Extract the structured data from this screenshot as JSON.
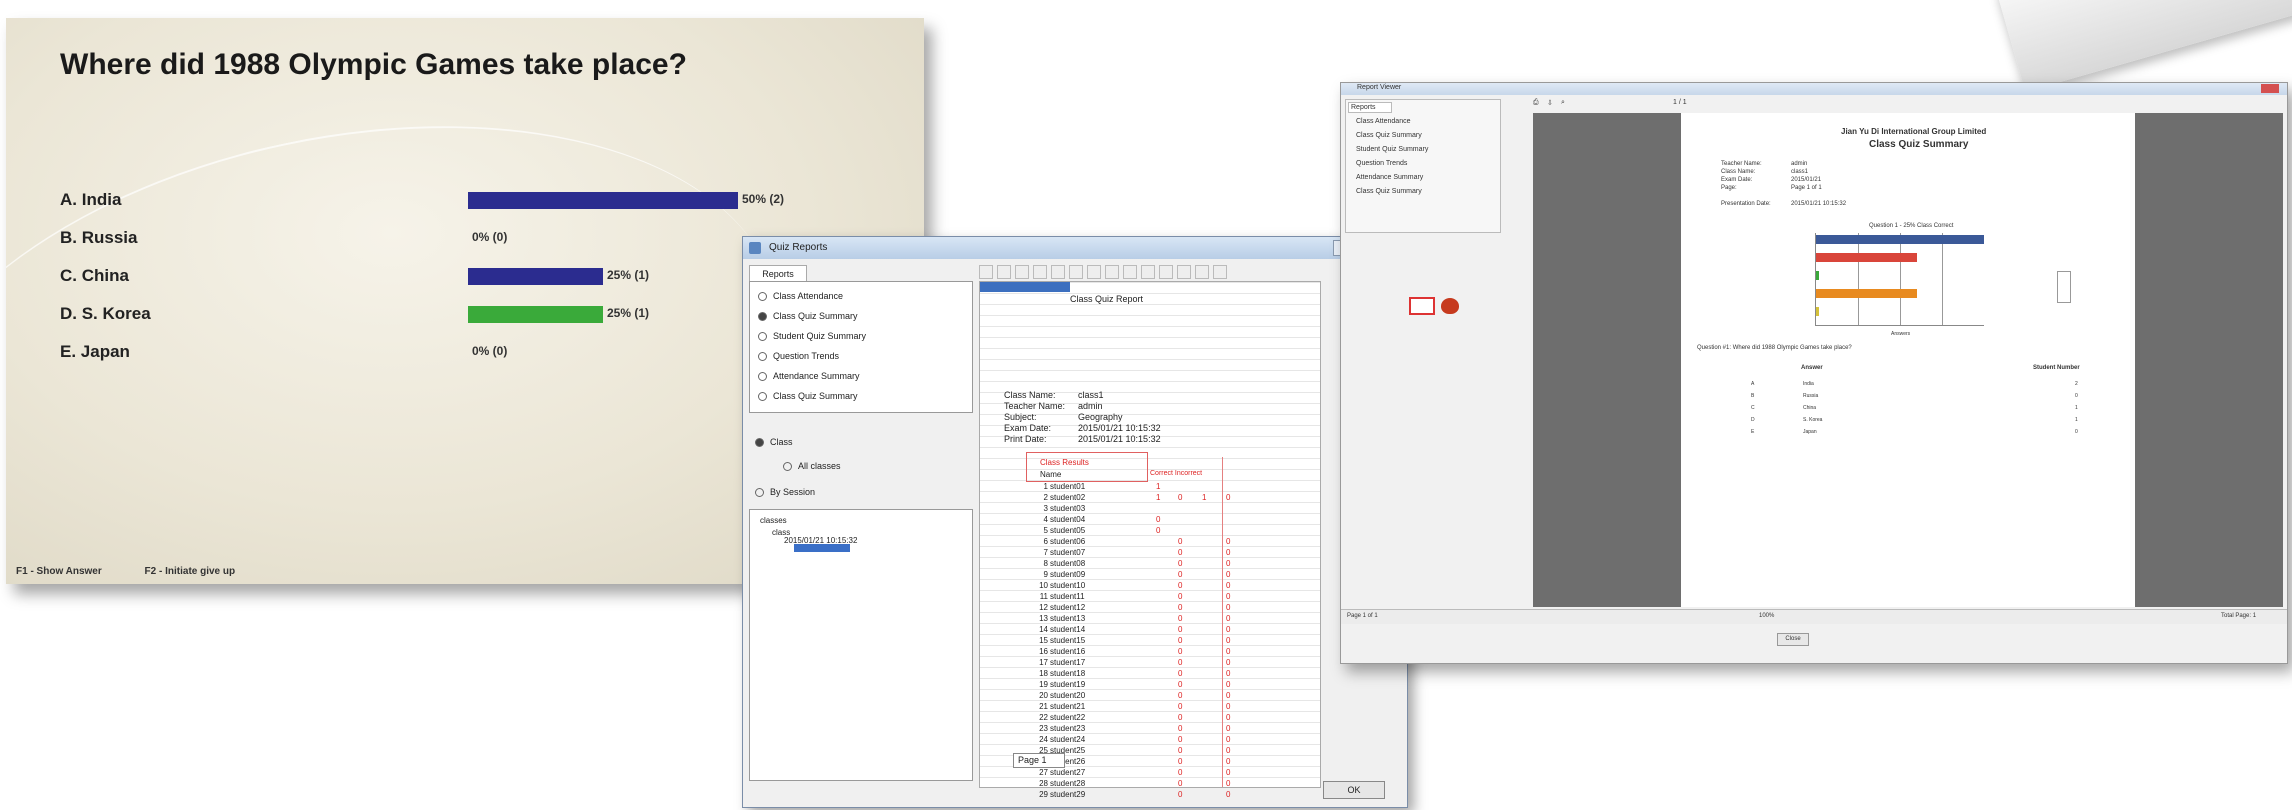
{
  "quiz": {
    "question": "Where did 1988 Olympic Games take place?",
    "answers": [
      {
        "label": "A. India",
        "percent": 50,
        "value_text": "50% (2)",
        "color": "#2b2c8f"
      },
      {
        "label": "B. Russia",
        "percent": 0,
        "value_text": "0% (0)",
        "color": "#2b2c8f"
      },
      {
        "label": "C. China",
        "percent": 25,
        "value_text": "25% (1)",
        "color": "#2b2c8f"
      },
      {
        "label": "D. S. Korea",
        "percent": 25,
        "value_text": "25% (1)",
        "color": "#3aaa3a"
      },
      {
        "label": "E. Japan",
        "percent": 0,
        "value_text": "0% (0)",
        "color": "#2b2c8f"
      }
    ],
    "footer": [
      "F1 - Show Answer",
      "F2 - Initiate give up"
    ]
  },
  "teacher": {
    "title": "Quiz Reports",
    "tab": "Reports",
    "reports": [
      "Class Attendance",
      "Class Quiz Summary",
      "Student Quiz Summary",
      "Question Trends",
      "Attendance Summary",
      "Class Quiz Summary"
    ],
    "selected_report_index": 1,
    "options": {
      "class": "Class",
      "all_classes": "All classes",
      "by_session": "By Session"
    },
    "tree": [
      "classes",
      "class",
      "2015/01/21 10:15:32"
    ],
    "quiz_header": "Class Quiz Report",
    "info": [
      {
        "k": "Class Name:",
        "v": "class1"
      },
      {
        "k": "Teacher Name:",
        "v": "admin"
      },
      {
        "k": "Subject:",
        "v": "Geography"
      },
      {
        "k": "Exam Date:",
        "v": "2015/01/21 10:15:32"
      },
      {
        "k": "Print Date:",
        "v": "2015/01/21 10:15:32"
      }
    ],
    "results_label": "Class Results",
    "results_sub": "Name",
    "results_hdr": "Correct   Incorrect",
    "students": [
      {
        "n": "1",
        "name": "student01",
        "c": [
          "1",
          "",
          "",
          ""
        ]
      },
      {
        "n": "2",
        "name": "student02",
        "c": [
          "1",
          "0",
          "1",
          "0"
        ]
      },
      {
        "n": "3",
        "name": "student03",
        "c": [
          "",
          "",
          "",
          ""
        ]
      },
      {
        "n": "4",
        "name": "student04",
        "c": [
          "0",
          "",
          "",
          ""
        ]
      },
      {
        "n": "5",
        "name": "student05",
        "c": [
          "0",
          "",
          "",
          ""
        ]
      },
      {
        "n": "6",
        "name": "student06",
        "c": [
          "",
          "0",
          "",
          "0"
        ]
      },
      {
        "n": "7",
        "name": "student07",
        "c": [
          "",
          "0",
          "",
          "0"
        ]
      },
      {
        "n": "8",
        "name": "student08",
        "c": [
          "",
          "0",
          "",
          "0"
        ]
      },
      {
        "n": "9",
        "name": "student09",
        "c": [
          "",
          "0",
          "",
          "0"
        ]
      },
      {
        "n": "10",
        "name": "student10",
        "c": [
          "",
          "0",
          "",
          "0"
        ]
      },
      {
        "n": "11",
        "name": "student11",
        "c": [
          "",
          "0",
          "",
          "0"
        ]
      },
      {
        "n": "12",
        "name": "student12",
        "c": [
          "",
          "0",
          "",
          "0"
        ]
      },
      {
        "n": "13",
        "name": "student13",
        "c": [
          "",
          "0",
          "",
          "0"
        ]
      },
      {
        "n": "14",
        "name": "student14",
        "c": [
          "",
          "0",
          "",
          "0"
        ]
      },
      {
        "n": "15",
        "name": "student15",
        "c": [
          "",
          "0",
          "",
          "0"
        ]
      },
      {
        "n": "16",
        "name": "student16",
        "c": [
          "",
          "0",
          "",
          "0"
        ]
      },
      {
        "n": "17",
        "name": "student17",
        "c": [
          "",
          "0",
          "",
          "0"
        ]
      },
      {
        "n": "18",
        "name": "student18",
        "c": [
          "",
          "0",
          "",
          "0"
        ]
      },
      {
        "n": "19",
        "name": "student19",
        "c": [
          "",
          "0",
          "",
          "0"
        ]
      },
      {
        "n": "20",
        "name": "student20",
        "c": [
          "",
          "0",
          "",
          "0"
        ]
      },
      {
        "n": "21",
        "name": "student21",
        "c": [
          "",
          "0",
          "",
          "0"
        ]
      },
      {
        "n": "22",
        "name": "student22",
        "c": [
          "",
          "0",
          "",
          "0"
        ]
      },
      {
        "n": "23",
        "name": "student23",
        "c": [
          "",
          "0",
          "",
          "0"
        ]
      },
      {
        "n": "24",
        "name": "student24",
        "c": [
          "",
          "0",
          "",
          "0"
        ]
      },
      {
        "n": "25",
        "name": "student25",
        "c": [
          "",
          "0",
          "",
          "0"
        ]
      },
      {
        "n": "26",
        "name": "student26",
        "c": [
          "",
          "0",
          "",
          "0"
        ]
      },
      {
        "n": "27",
        "name": "student27",
        "c": [
          "",
          "0",
          "",
          "0"
        ]
      },
      {
        "n": "28",
        "name": "student28",
        "c": [
          "",
          "0",
          "",
          "0"
        ]
      },
      {
        "n": "29",
        "name": "student29",
        "c": [
          "",
          "0",
          "",
          "0"
        ]
      }
    ],
    "page_select": "Page 1",
    "ok_label": "OK"
  },
  "preview": {
    "title": "Report Viewer",
    "nav_tab": "Reports",
    "nav_items": [
      "Class Attendance",
      "Class Quiz Summary",
      "Student Quiz Summary",
      "Question Trends",
      "Attendance Summary",
      "Class Quiz Summary"
    ],
    "toolbar_page": "1 / 1",
    "company": "Jian Yu Di International Group Limited",
    "report_title": "Class Quiz Summary",
    "meta": [
      {
        "k": "Teacher Name:",
        "v": "admin"
      },
      {
        "k": "Class Name:",
        "v": "class1"
      },
      {
        "k": "Exam Date:",
        "v": "2015/01/21"
      },
      {
        "k": "Page:",
        "v": "Page 1 of 1"
      }
    ],
    "presentation": {
      "k": "Presentation Date:",
      "v": "2015/01/21 10:15:32"
    },
    "chart_caption": "Question 1 - 25% Class Correct",
    "mini_bars": [
      {
        "value": 100,
        "color": "#3b5998"
      },
      {
        "value": 60,
        "color": "#d9453a"
      },
      {
        "value": 2,
        "color": "#3aa83a"
      },
      {
        "value": 60,
        "color": "#e88a1f"
      },
      {
        "value": 2,
        "color": "#d4c13a"
      }
    ],
    "mini_axis": "Answers",
    "table_caption": "Question #1: Where did 1988 Olympic Games take place?",
    "col_answer": "Answer",
    "col_students": "Student Number",
    "rows": [
      {
        "n": "A",
        "a": "India",
        "s": "2"
      },
      {
        "n": "B",
        "a": "Russia",
        "s": "0"
      },
      {
        "n": "C",
        "a": "China",
        "s": "1"
      },
      {
        "n": "D",
        "a": "S. Korea",
        "s": "1"
      },
      {
        "n": "E",
        "a": "Japan",
        "s": "0"
      }
    ],
    "status_left": "Page 1 of 1",
    "status_mid": "100%",
    "status_right": "Total Page: 1",
    "close_label": "Close"
  }
}
